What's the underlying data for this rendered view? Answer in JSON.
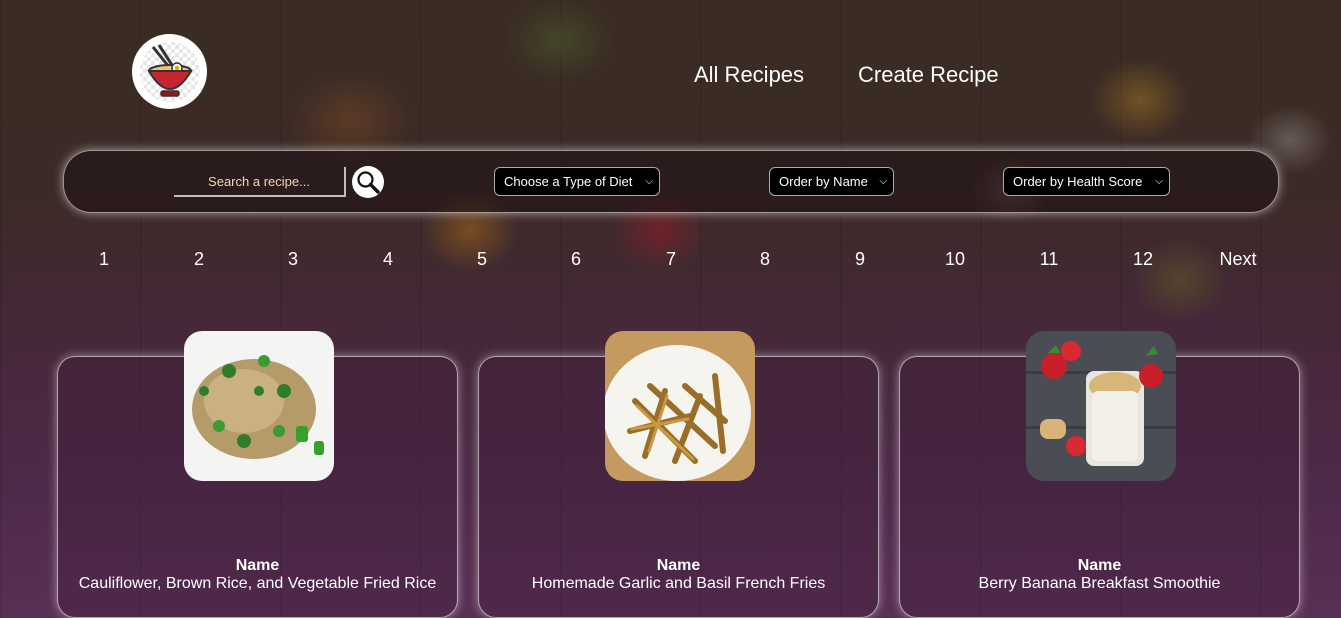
{
  "header": {
    "logo_icon": "ramen-bowl-logo-icon",
    "nav": [
      "All Recipes",
      "Create Recipe"
    ]
  },
  "filters": {
    "search": {
      "placeholder": "Search a recipe...",
      "value": ""
    },
    "search_icon": "magnifier-icon",
    "diet_select": "Choose a Type of Diet",
    "order_name_select": "Order by Name",
    "order_health_select": "Order by Health Score"
  },
  "pagination": [
    "1",
    "2",
    "3",
    "4",
    "5",
    "6",
    "7",
    "8",
    "9",
    "10",
    "11",
    "12",
    "Next"
  ],
  "recipes": [
    {
      "label": "Name",
      "title": "Cauliflower, Brown Rice, and Vegetable Fried Rice"
    },
    {
      "label": "Name",
      "title": "Homemade Garlic and Basil French Fries"
    },
    {
      "label": "Name",
      "title": "Berry Banana Breakfast Smoothie"
    }
  ],
  "colors": {
    "accent": "#ffffff",
    "search_text": "#f3d9b0",
    "select_bg": "#000000"
  }
}
